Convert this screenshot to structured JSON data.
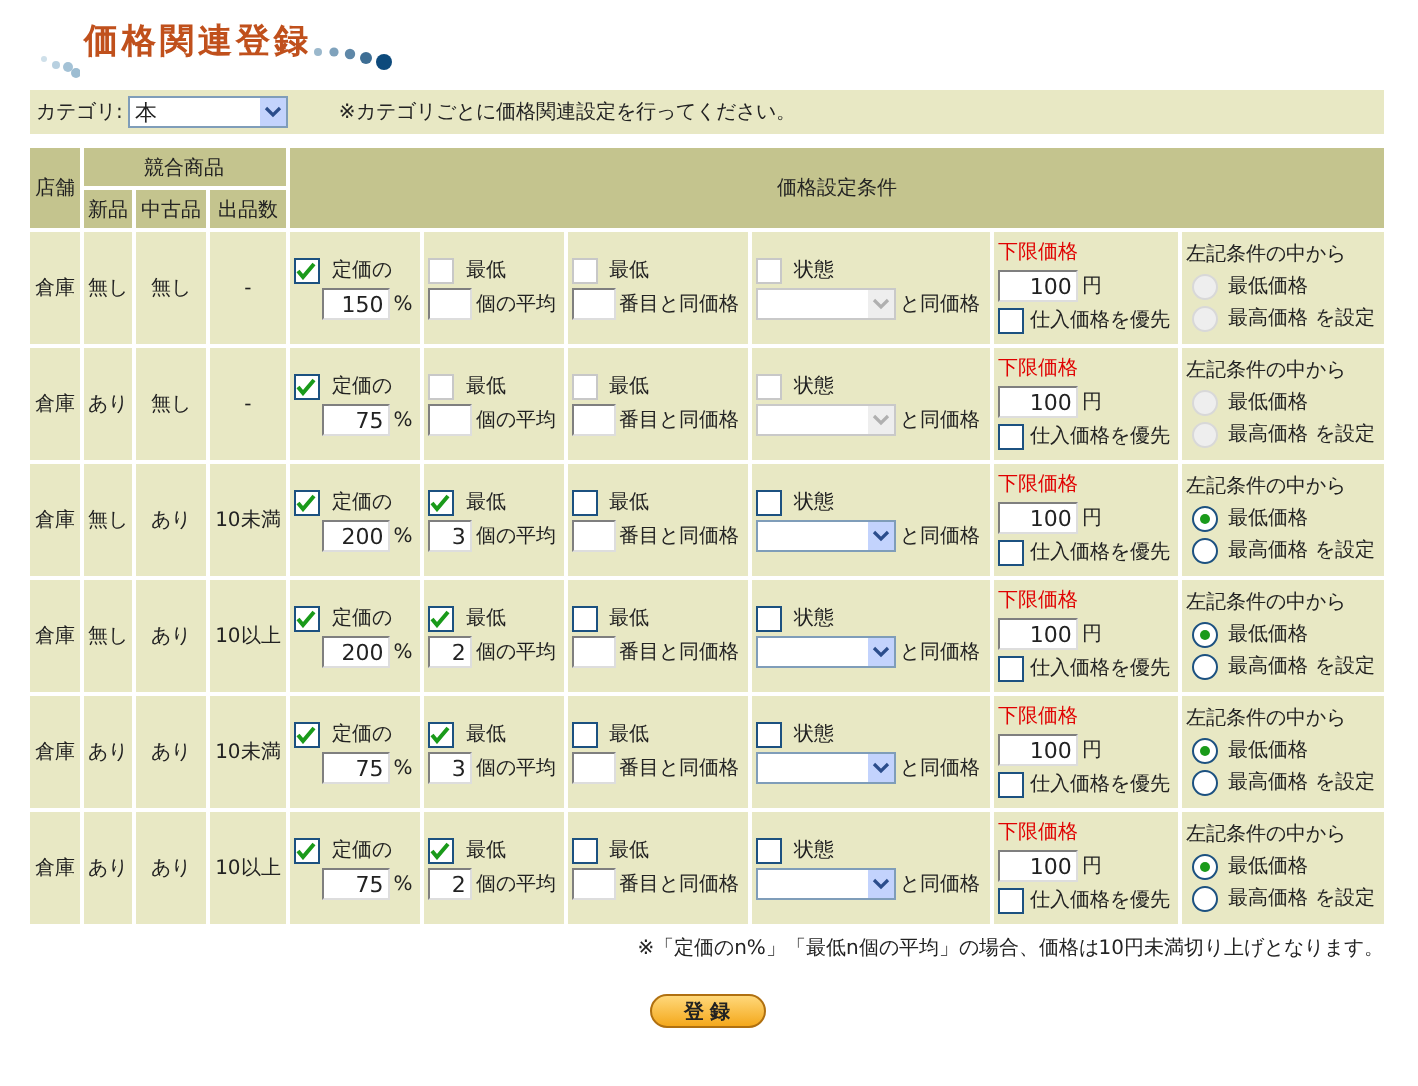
{
  "title": "価格関連登録",
  "category": {
    "label": "カテゴリ:",
    "value": "本",
    "note": "※カテゴリごとに価格関連設定を行ってください。"
  },
  "table": {
    "headers": {
      "store": "店舗",
      "competitors": "競合商品",
      "new": "新品",
      "used": "中古品",
      "count": "出品数",
      "conditions": "価格設定条件"
    },
    "rows": [
      {
        "store": "倉庫",
        "new": "無し",
        "used": "無し",
        "count": "-",
        "disabled": true,
        "list_price": {
          "label": "定価の",
          "checked": true,
          "value": "150",
          "unit": "%"
        },
        "lowest_avg": {
          "label": "最低",
          "checked": false,
          "suffix": "個の平均"
        },
        "nth_lowest": {
          "label": "最低",
          "checked": false,
          "suffix": "番目と同価格"
        },
        "condition": {
          "label": "状態",
          "checked": false,
          "suffix": "と同価格"
        },
        "min_price": {
          "label": "下限価格",
          "value": "100",
          "unit": "円",
          "cost_label": "仕入価格を優先",
          "cost_checked": false
        },
        "choose": {
          "label": "左記条件の中から",
          "options": [
            {
              "label": "最低価格",
              "selected": false
            },
            {
              "label": "最高価格 を設定",
              "selected": false
            }
          ]
        }
      },
      {
        "store": "倉庫",
        "new": "あり",
        "used": "無し",
        "count": "-",
        "disabled": true,
        "list_price": {
          "label": "定価の",
          "checked": true,
          "value": "75",
          "unit": "%"
        },
        "lowest_avg": {
          "label": "最低",
          "checked": false,
          "suffix": "個の平均"
        },
        "nth_lowest": {
          "label": "最低",
          "checked": false,
          "suffix": "番目と同価格"
        },
        "condition": {
          "label": "状態",
          "checked": false,
          "suffix": "と同価格"
        },
        "min_price": {
          "label": "下限価格",
          "value": "100",
          "unit": "円",
          "cost_label": "仕入価格を優先",
          "cost_checked": false
        },
        "choose": {
          "label": "左記条件の中から",
          "options": [
            {
              "label": "最低価格",
              "selected": false
            },
            {
              "label": "最高価格 を設定",
              "selected": false
            }
          ]
        }
      },
      {
        "store": "倉庫",
        "new": "無し",
        "used": "あり",
        "count": "10未満",
        "disabled": false,
        "list_price": {
          "label": "定価の",
          "checked": true,
          "value": "200",
          "unit": "%"
        },
        "lowest_avg": {
          "label": "最低",
          "checked": true,
          "value": "3",
          "suffix": "個の平均"
        },
        "nth_lowest": {
          "label": "最低",
          "checked": false,
          "suffix": "番目と同価格"
        },
        "condition": {
          "label": "状態",
          "checked": false,
          "suffix": "と同価格"
        },
        "min_price": {
          "label": "下限価格",
          "value": "100",
          "unit": "円",
          "cost_label": "仕入価格を優先",
          "cost_checked": false
        },
        "choose": {
          "label": "左記条件の中から",
          "options": [
            {
              "label": "最低価格",
              "selected": true
            },
            {
              "label": "最高価格 を設定",
              "selected": false
            }
          ]
        }
      },
      {
        "store": "倉庫",
        "new": "無し",
        "used": "あり",
        "count": "10以上",
        "disabled": false,
        "list_price": {
          "label": "定価の",
          "checked": true,
          "value": "200",
          "unit": "%"
        },
        "lowest_avg": {
          "label": "最低",
          "checked": true,
          "value": "2",
          "suffix": "個の平均"
        },
        "nth_lowest": {
          "label": "最低",
          "checked": false,
          "suffix": "番目と同価格"
        },
        "condition": {
          "label": "状態",
          "checked": false,
          "suffix": "と同価格"
        },
        "min_price": {
          "label": "下限価格",
          "value": "100",
          "unit": "円",
          "cost_label": "仕入価格を優先",
          "cost_checked": false
        },
        "choose": {
          "label": "左記条件の中から",
          "options": [
            {
              "label": "最低価格",
              "selected": true
            },
            {
              "label": "最高価格 を設定",
              "selected": false
            }
          ]
        }
      },
      {
        "store": "倉庫",
        "new": "あり",
        "used": "あり",
        "count": "10未満",
        "disabled": false,
        "list_price": {
          "label": "定価の",
          "checked": true,
          "value": "75",
          "unit": "%"
        },
        "lowest_avg": {
          "label": "最低",
          "checked": true,
          "value": "3",
          "suffix": "個の平均"
        },
        "nth_lowest": {
          "label": "最低",
          "checked": false,
          "suffix": "番目と同価格"
        },
        "condition": {
          "label": "状態",
          "checked": false,
          "suffix": "と同価格"
        },
        "min_price": {
          "label": "下限価格",
          "value": "100",
          "unit": "円",
          "cost_label": "仕入価格を優先",
          "cost_checked": false
        },
        "choose": {
          "label": "左記条件の中から",
          "options": [
            {
              "label": "最低価格",
              "selected": true
            },
            {
              "label": "最高価格 を設定",
              "selected": false
            }
          ]
        }
      },
      {
        "store": "倉庫",
        "new": "あり",
        "used": "あり",
        "count": "10以上",
        "disabled": false,
        "list_price": {
          "label": "定価の",
          "checked": true,
          "value": "75",
          "unit": "%"
        },
        "lowest_avg": {
          "label": "最低",
          "checked": true,
          "value": "2",
          "suffix": "個の平均"
        },
        "nth_lowest": {
          "label": "最低",
          "checked": false,
          "suffix": "番目と同価格"
        },
        "condition": {
          "label": "状態",
          "checked": false,
          "suffix": "と同価格"
        },
        "min_price": {
          "label": "下限価格",
          "value": "100",
          "unit": "円",
          "cost_label": "仕入価格を優先",
          "cost_checked": false
        },
        "choose": {
          "label": "左記条件の中から",
          "options": [
            {
              "label": "最低価格",
              "selected": true
            },
            {
              "label": "最高価格 を設定",
              "selected": false
            }
          ]
        }
      }
    ]
  },
  "footnote": "※「定価のn%」「最低n個の平均」の場合、価格は10円未満切り上げとなります。",
  "submit": "登 録"
}
